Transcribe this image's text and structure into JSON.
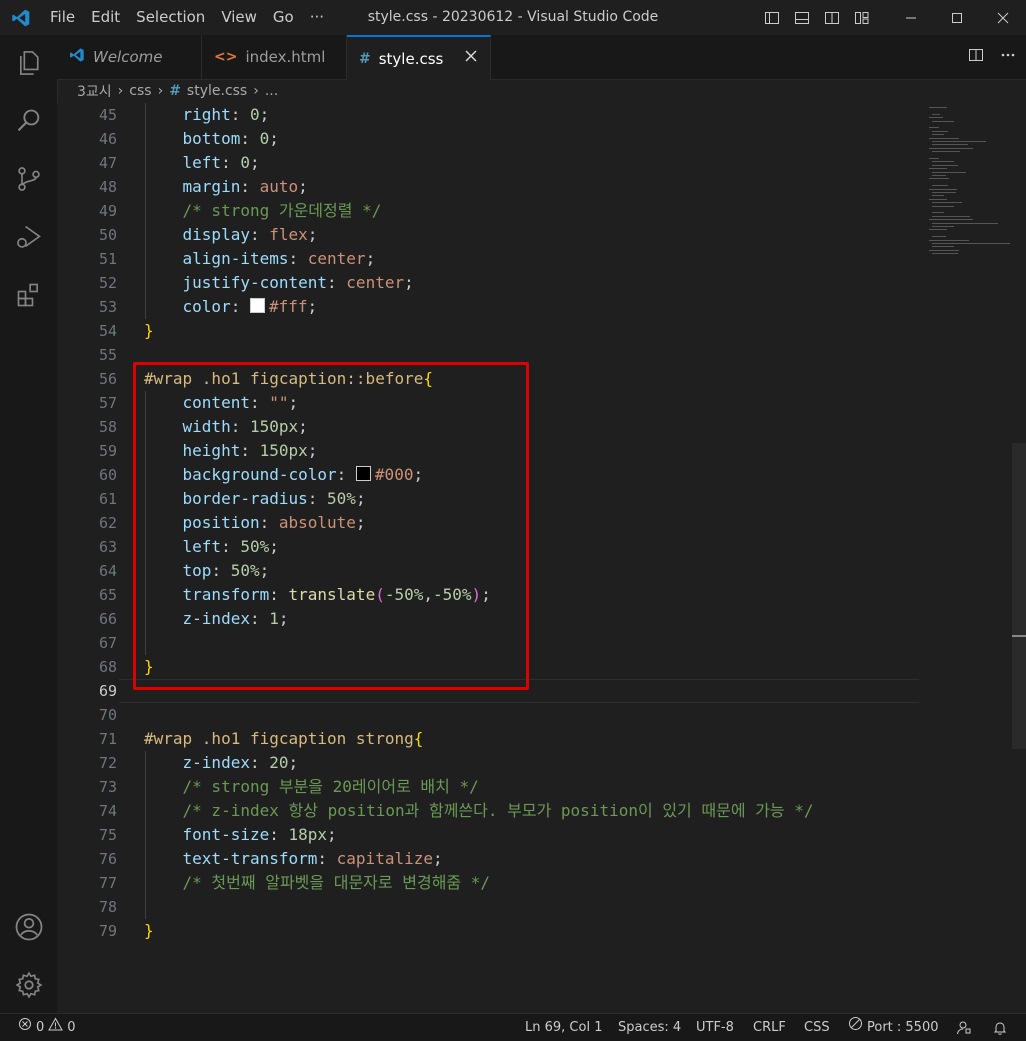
{
  "window": {
    "title": "style.css - 20230612 - Visual Studio Code",
    "menu": [
      "File",
      "Edit",
      "Selection",
      "View",
      "Go",
      "···"
    ]
  },
  "tabs": [
    {
      "label": "Welcome",
      "icon": "vscode-icon",
      "active": false
    },
    {
      "label": "index.html",
      "icon": "html-icon",
      "active": false
    },
    {
      "label": "style.css",
      "icon": "css-icon",
      "active": true
    }
  ],
  "breadcrumb": {
    "folder": "3교시",
    "sub": "css",
    "file": "style.css",
    "more": "..."
  },
  "editor": {
    "current_line": 69,
    "lines": [
      {
        "n": 45,
        "tokens": [
          [
            "    ",
            ""
          ],
          [
            "right",
            "prop"
          ],
          [
            ": ",
            "punc"
          ],
          [
            "0",
            "num"
          ],
          [
            ";",
            "punc"
          ]
        ]
      },
      {
        "n": 46,
        "tokens": [
          [
            "    ",
            ""
          ],
          [
            "bottom",
            "prop"
          ],
          [
            ": ",
            "punc"
          ],
          [
            "0",
            "num"
          ],
          [
            ";",
            "punc"
          ]
        ]
      },
      {
        "n": 47,
        "tokens": [
          [
            "    ",
            ""
          ],
          [
            "left",
            "prop"
          ],
          [
            ": ",
            "punc"
          ],
          [
            "0",
            "num"
          ],
          [
            ";",
            "punc"
          ]
        ]
      },
      {
        "n": 48,
        "tokens": [
          [
            "    ",
            ""
          ],
          [
            "margin",
            "prop"
          ],
          [
            ": ",
            "punc"
          ],
          [
            "auto",
            "val"
          ],
          [
            ";",
            "punc"
          ]
        ]
      },
      {
        "n": 49,
        "tokens": [
          [
            "    ",
            ""
          ],
          [
            "/* strong 가운데정렬 */",
            "cmt"
          ]
        ]
      },
      {
        "n": 50,
        "tokens": [
          [
            "    ",
            ""
          ],
          [
            "display",
            "prop"
          ],
          [
            ": ",
            "punc"
          ],
          [
            "flex",
            "val"
          ],
          [
            ";",
            "punc"
          ]
        ]
      },
      {
        "n": 51,
        "tokens": [
          [
            "    ",
            ""
          ],
          [
            "align-items",
            "prop"
          ],
          [
            ": ",
            "punc"
          ],
          [
            "center",
            "val"
          ],
          [
            ";",
            "punc"
          ]
        ]
      },
      {
        "n": 52,
        "tokens": [
          [
            "    ",
            ""
          ],
          [
            "justify-content",
            "prop"
          ],
          [
            ": ",
            "punc"
          ],
          [
            "center",
            "val"
          ],
          [
            ";",
            "punc"
          ]
        ]
      },
      {
        "n": 53,
        "tokens": [
          [
            "    ",
            ""
          ],
          [
            "color",
            "prop"
          ],
          [
            ": ",
            "punc"
          ],
          [
            "#ffffff",
            "swatch"
          ],
          [
            "#fff",
            "val"
          ],
          [
            ";",
            "punc"
          ]
        ]
      },
      {
        "n": 54,
        "tokens": [
          [
            "}",
            "brace"
          ]
        ]
      },
      {
        "n": 55,
        "tokens": []
      },
      {
        "n": 56,
        "tokens": [
          [
            "#wrap .ho1 figcaption::before",
            "sel"
          ],
          [
            "{",
            "brace"
          ]
        ]
      },
      {
        "n": 57,
        "tokens": [
          [
            "    ",
            ""
          ],
          [
            "content",
            "prop"
          ],
          [
            ": ",
            "punc"
          ],
          [
            "\"\"",
            "val"
          ],
          [
            ";",
            "punc"
          ]
        ]
      },
      {
        "n": 58,
        "tokens": [
          [
            "    ",
            ""
          ],
          [
            "width",
            "prop"
          ],
          [
            ": ",
            "punc"
          ],
          [
            "150px",
            "num"
          ],
          [
            ";",
            "punc"
          ]
        ]
      },
      {
        "n": 59,
        "tokens": [
          [
            "    ",
            ""
          ],
          [
            "height",
            "prop"
          ],
          [
            ": ",
            "punc"
          ],
          [
            "150px",
            "num"
          ],
          [
            ";",
            "punc"
          ]
        ]
      },
      {
        "n": 60,
        "tokens": [
          [
            "    ",
            ""
          ],
          [
            "background-color",
            "prop"
          ],
          [
            ": ",
            "punc"
          ],
          [
            "#000000",
            "swatch"
          ],
          [
            "#000",
            "val"
          ],
          [
            ";",
            "punc"
          ]
        ]
      },
      {
        "n": 61,
        "tokens": [
          [
            "    ",
            ""
          ],
          [
            "border-radius",
            "prop"
          ],
          [
            ": ",
            "punc"
          ],
          [
            "50%",
            "num"
          ],
          [
            ";",
            "punc"
          ]
        ]
      },
      {
        "n": 62,
        "tokens": [
          [
            "    ",
            ""
          ],
          [
            "position",
            "prop"
          ],
          [
            ": ",
            "punc"
          ],
          [
            "absolute",
            "val"
          ],
          [
            ";",
            "punc"
          ]
        ]
      },
      {
        "n": 63,
        "tokens": [
          [
            "    ",
            ""
          ],
          [
            "left",
            "prop"
          ],
          [
            ": ",
            "punc"
          ],
          [
            "50%",
            "num"
          ],
          [
            ";",
            "punc"
          ]
        ]
      },
      {
        "n": 64,
        "tokens": [
          [
            "    ",
            ""
          ],
          [
            "top",
            "prop"
          ],
          [
            ": ",
            "punc"
          ],
          [
            "50%",
            "num"
          ],
          [
            ";",
            "punc"
          ]
        ]
      },
      {
        "n": 65,
        "tokens": [
          [
            "    ",
            ""
          ],
          [
            "transform",
            "prop"
          ],
          [
            ": ",
            "punc"
          ],
          [
            "translate",
            "fn"
          ],
          [
            "(",
            "paren"
          ],
          [
            "-50%",
            "num"
          ],
          [
            ",",
            "punc"
          ],
          [
            "-50%",
            "num"
          ],
          [
            ")",
            "paren"
          ],
          [
            ";",
            "punc"
          ]
        ]
      },
      {
        "n": 66,
        "tokens": [
          [
            "    ",
            ""
          ],
          [
            "z-index",
            "prop"
          ],
          [
            ": ",
            "punc"
          ],
          [
            "1",
            "num"
          ],
          [
            ";",
            "punc"
          ]
        ]
      },
      {
        "n": 67,
        "tokens": []
      },
      {
        "n": 68,
        "tokens": [
          [
            "}",
            "brace"
          ]
        ]
      },
      {
        "n": 69,
        "tokens": []
      },
      {
        "n": 70,
        "tokens": []
      },
      {
        "n": 71,
        "tokens": [
          [
            "#wrap .ho1 figcaption strong",
            "sel"
          ],
          [
            "{",
            "brace"
          ]
        ]
      },
      {
        "n": 72,
        "tokens": [
          [
            "    ",
            ""
          ],
          [
            "z-index",
            "prop"
          ],
          [
            ": ",
            "punc"
          ],
          [
            "20",
            "num"
          ],
          [
            ";",
            "punc"
          ]
        ]
      },
      {
        "n": 73,
        "tokens": [
          [
            "    ",
            ""
          ],
          [
            "/* strong 부분을 20레이어로 배치 */",
            "cmt"
          ]
        ]
      },
      {
        "n": 74,
        "tokens": [
          [
            "    ",
            ""
          ],
          [
            "/* z-index 항상 position과 함께쓴다. 부모가 position이 있기 때문에 가능 */",
            "cmt"
          ]
        ]
      },
      {
        "n": 75,
        "tokens": [
          [
            "    ",
            ""
          ],
          [
            "font-size",
            "prop"
          ],
          [
            ": ",
            "punc"
          ],
          [
            "18px",
            "num"
          ],
          [
            ";",
            "punc"
          ]
        ]
      },
      {
        "n": 76,
        "tokens": [
          [
            "    ",
            ""
          ],
          [
            "text-transform",
            "prop"
          ],
          [
            ": ",
            "punc"
          ],
          [
            "capitalize",
            "val"
          ],
          [
            ";",
            "punc"
          ]
        ]
      },
      {
        "n": 77,
        "tokens": [
          [
            "    ",
            ""
          ],
          [
            "/* 첫번째 알파벳을 대문자로 변경해줌 */",
            "cmt"
          ]
        ]
      },
      {
        "n": 78,
        "tokens": []
      },
      {
        "n": 79,
        "tokens": [
          [
            "}",
            "brace"
          ]
        ]
      }
    ]
  },
  "status": {
    "errors": "0",
    "warnings": "0",
    "position": "Ln 69, Col 1",
    "spaces": "Spaces: 4",
    "encoding": "UTF-8",
    "eol": "CRLF",
    "language": "CSS",
    "port": "Port : 5500"
  },
  "colors": {
    "accent": "#0078d4",
    "highlight_box": "#e00000"
  }
}
